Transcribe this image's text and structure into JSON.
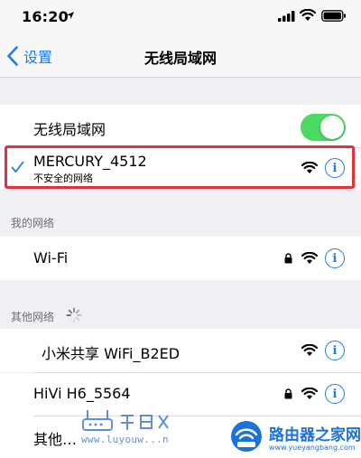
{
  "status_bar": {
    "time": "16:20"
  },
  "nav": {
    "back_label": "设置",
    "title": "无线局域网"
  },
  "wlan_toggle": {
    "label": "无线局域网",
    "enabled": true
  },
  "connected_network": {
    "name": "MERCURY_4512",
    "subtitle": "不安全的网络",
    "selected": true
  },
  "my_networks": {
    "header": "我的网络",
    "items": [
      {
        "name": "Wi-Fi",
        "locked": true
      }
    ]
  },
  "other_networks": {
    "header": "其他网络",
    "items": [
      {
        "name": "小米共享 WiFi_B2ED",
        "locked": false
      },
      {
        "name": "HiVi H6_5564",
        "locked": true
      },
      {
        "name": "其他…"
      }
    ]
  },
  "watermarks": {
    "left_domain": "www.luyouw...n",
    "right_title": "路由器之家网",
    "right_domain": "www.yueyangbang.com"
  },
  "colors": {
    "accent": "#1a7cf5",
    "toggle_on": "#4cd964",
    "highlight": "#e8303c"
  }
}
